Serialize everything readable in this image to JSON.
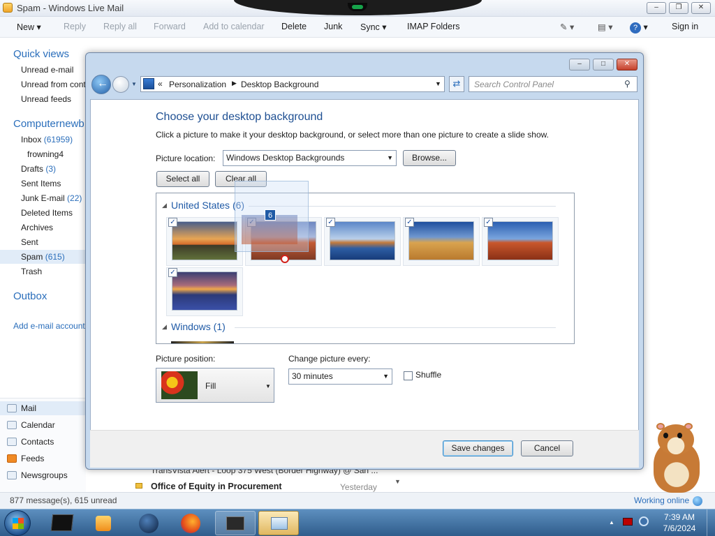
{
  "mail_window": {
    "title": "Spam - Windows Live Mail",
    "toolbar": {
      "new": "New",
      "reply": "Reply",
      "reply_all": "Reply all",
      "forward": "Forward",
      "add_to_calendar": "Add to calendar",
      "delete": "Delete",
      "junk": "Junk",
      "sync": "Sync",
      "imap_folders": "IMAP Folders",
      "sign_in": "Sign in"
    },
    "sidebar": {
      "quick_views": "Quick views",
      "quick_items": [
        "Unread e-mail",
        "Unread from cont",
        "Unread feeds"
      ],
      "account": "Computernewb",
      "folders": [
        {
          "label": "Inbox",
          "count": "(61959)"
        },
        {
          "label": "frowning4",
          "count": ""
        },
        {
          "label": "Drafts",
          "count": "(3)"
        },
        {
          "label": "Sent Items",
          "count": ""
        },
        {
          "label": "Junk E-mail",
          "count": "(22)"
        },
        {
          "label": "Deleted Items",
          "count": ""
        },
        {
          "label": "Archives",
          "count": ""
        },
        {
          "label": "Sent",
          "count": ""
        },
        {
          "label": "Spam",
          "count": "(615)"
        },
        {
          "label": "Trash",
          "count": ""
        }
      ],
      "outbox": "Outbox",
      "add_account": "Add e-mail account",
      "bottom_nav": [
        "Mail",
        "Calendar",
        "Contacts",
        "Feeds",
        "Newsgroups"
      ]
    },
    "messages_peek": {
      "row1": "TransVista Alert - Loop 375 West (Border Highway) @ San ...",
      "row2_subject": "Office of Equity in Procurement",
      "row2_date": "Yesterday"
    },
    "status": {
      "left": "877 message(s), 615 unread",
      "right": "Working online"
    }
  },
  "dialog": {
    "breadcrumb": {
      "prefix": "«",
      "item1": "Personalization",
      "item2": "Desktop Background"
    },
    "search_placeholder": "Search Control Panel",
    "heading": "Choose your desktop background",
    "description": "Click a picture to make it your desktop background, or select more than one picture to create a slide show.",
    "picture_location_label": "Picture location:",
    "picture_location_value": "Windows Desktop Backgrounds",
    "browse": "Browse...",
    "select_all": "Select all",
    "clear_all": "Clear all",
    "drag_count": "6",
    "groups": [
      {
        "name": "United States (6)",
        "pictures": [
          "Golden sunset over field",
          "Red arch landscape",
          "Rock at lake",
          "Hay bale field",
          "Delicate Arch",
          "Flower field sunset"
        ]
      },
      {
        "name": "Windows (1)",
        "pictures": [
          "Windows"
        ]
      }
    ],
    "picture_position_label": "Picture position:",
    "picture_position_value": "Fill",
    "change_every_label": "Change picture every:",
    "change_every_value": "30 minutes",
    "shuffle_label": "Shuffle",
    "shuffle_checked": false,
    "save": "Save changes",
    "cancel": "Cancel"
  },
  "taskbar": {
    "time": "7:39 AM",
    "date": "7/6/2024"
  },
  "colors": {
    "accent_blue": "#2a6ebb",
    "dialog_frame": "#c6d9ee",
    "taskbar": "#3d6c9c"
  }
}
